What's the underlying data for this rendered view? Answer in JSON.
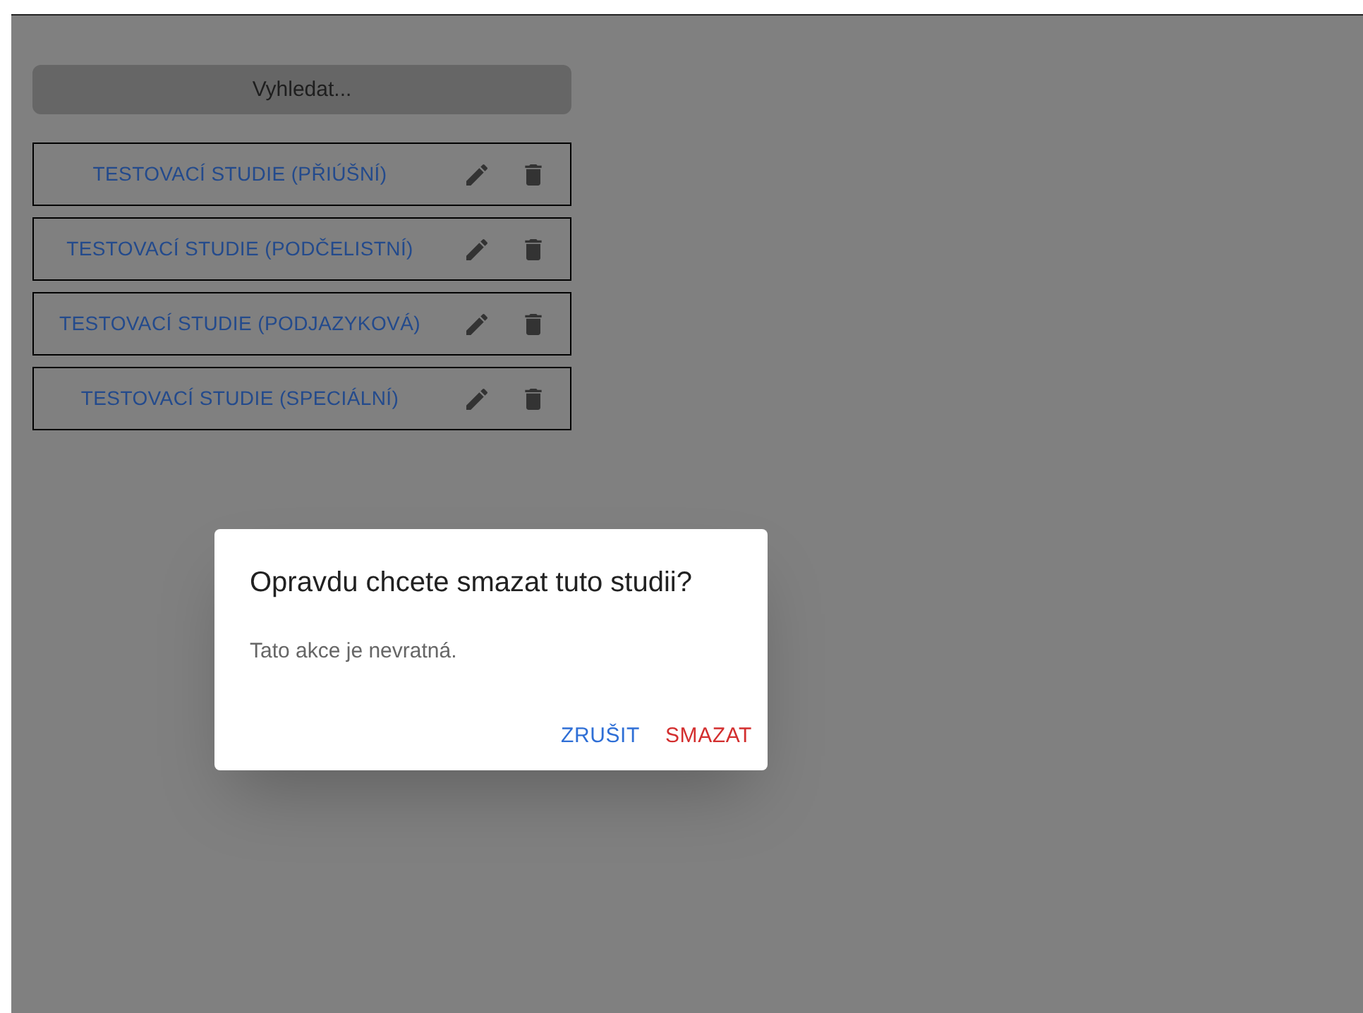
{
  "search": {
    "placeholder": "Vyhledat..."
  },
  "studies": [
    {
      "label": "TESTOVACÍ STUDIE (PŘIÚŠNÍ)"
    },
    {
      "label": "TESTOVACÍ STUDIE (PODČELISTNÍ)"
    },
    {
      "label": "TESTOVACÍ STUDIE (PODJAZYKOVÁ)"
    },
    {
      "label": "TESTOVACÍ STUDIE (SPECIÁLNÍ)"
    }
  ],
  "dialog": {
    "title": "Opravdu chcete smazat tuto studii?",
    "message": "Tato akce je nevratná.",
    "buttons": [
      {
        "label": "ZRUŠIT",
        "kind": "cancel"
      },
      {
        "label": "SMAZAT",
        "kind": "danger"
      }
    ]
  }
}
